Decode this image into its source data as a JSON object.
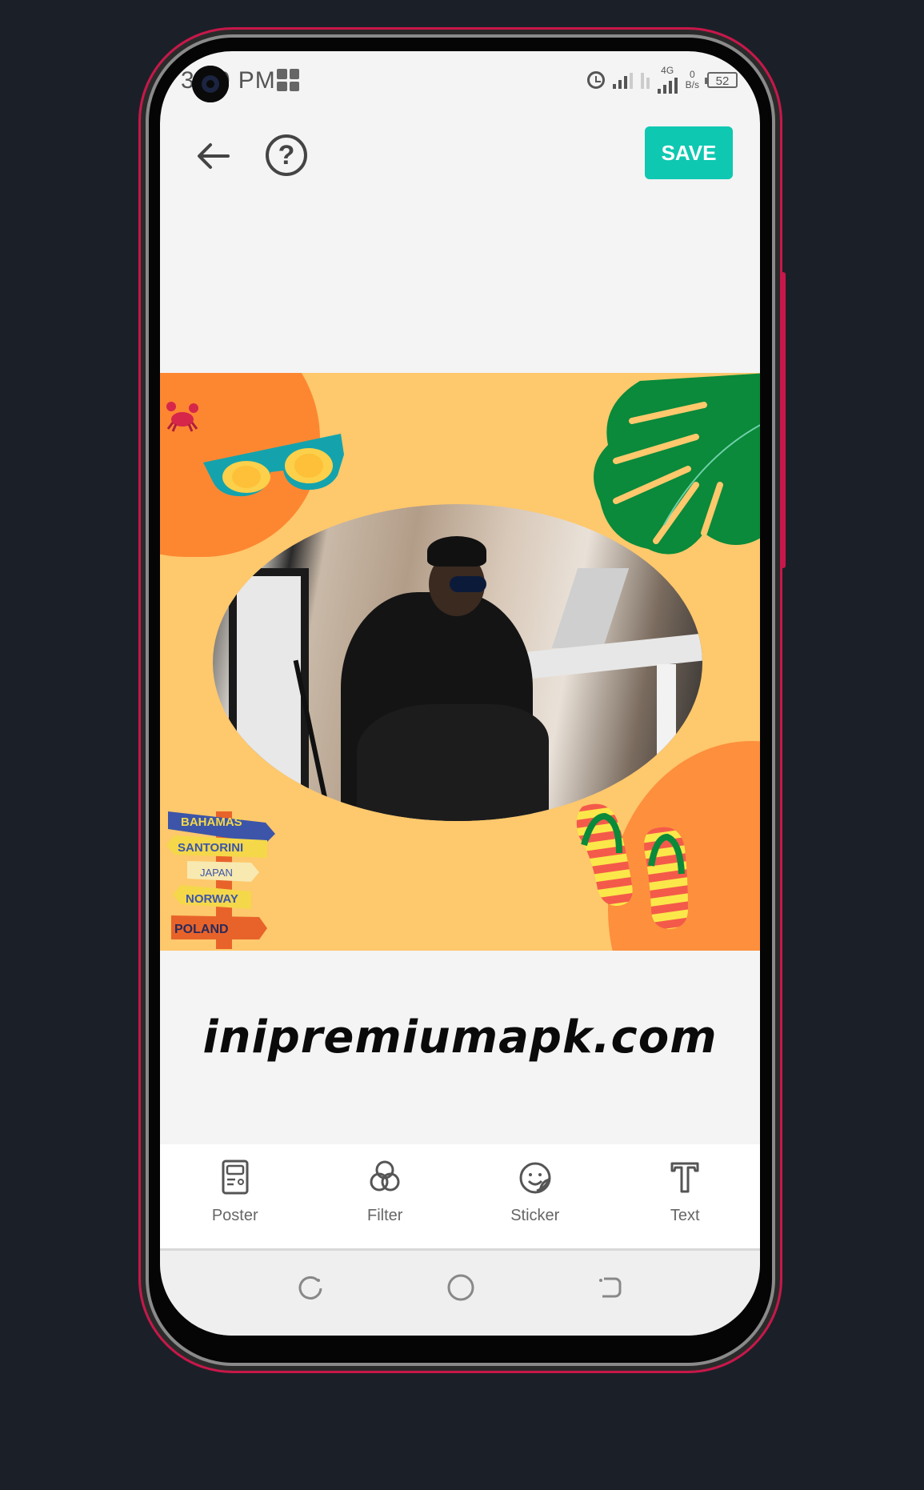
{
  "statusbar": {
    "time": "3:00 PM",
    "network_type": "4G",
    "net_speed_value": "0",
    "net_speed_unit": "B/s",
    "battery": "52"
  },
  "header": {
    "back_icon": "arrow-left-icon",
    "help_icon": "question-circle-icon",
    "save_label": "SAVE",
    "save_color": "#0fc8b1"
  },
  "poster": {
    "background_color": "#fec86c",
    "accent_color": "#fd8731",
    "leaf_color": "#0a8a3a",
    "stickers": [
      "crab",
      "sunglasses",
      "monstera-leaf",
      "signpost",
      "flip-flops"
    ],
    "signpost_labels": [
      "BAHAMAS",
      "SANTORINI",
      "JAPAN",
      "NORWAY",
      "POLAND"
    ]
  },
  "watermark": "inipremiumapk.com",
  "toolbar": {
    "items": [
      {
        "label": "Poster",
        "icon": "poster-icon"
      },
      {
        "label": "Filter",
        "icon": "filter-icon"
      },
      {
        "label": "Sticker",
        "icon": "sticker-icon"
      },
      {
        "label": "Text",
        "icon": "text-icon"
      }
    ]
  },
  "navbar": {
    "items": [
      "recent-apps-icon",
      "home-icon",
      "back-icon"
    ]
  }
}
